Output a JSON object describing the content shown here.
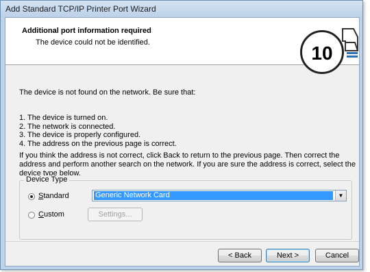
{
  "window": {
    "title": "Add Standard TCP/IP Printer Port Wizard"
  },
  "header": {
    "title": "Additional port information required",
    "subtitle": "The device could not be identified.",
    "badge": "10",
    "icon": "printer-port-wizard-icon"
  },
  "body": {
    "intro": "The device is not found on the network.  Be sure that:",
    "checklist": [
      "1.  The device is turned on.",
      "2.  The network is connected.",
      "3.  The device is properly configured.",
      "4.  The address on the previous page is correct."
    ],
    "instructions_line1": "If you think the address is not correct, click Back to return to the previous page.  Then correct the",
    "instructions_line2": "address and perform another search on the network.  If you are sure the address is correct, select the",
    "instructions_line3": "device type below."
  },
  "device_type": {
    "legend": "Device Type",
    "standard_label": "Standard",
    "standard_checked": true,
    "selected_device": "Generic Network Card",
    "custom_label": "Custom",
    "settings_label": "Settings..."
  },
  "buttons": {
    "back": "< Back",
    "next": "Next >",
    "cancel": "Cancel"
  }
}
